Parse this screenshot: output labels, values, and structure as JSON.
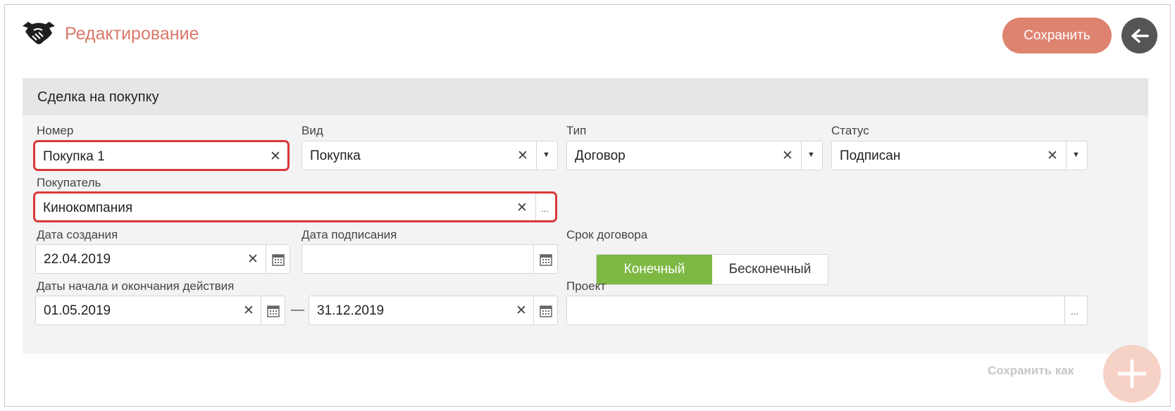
{
  "header": {
    "title": "Редактирование",
    "save_label": "Сохранить",
    "icon": "handshake-icon",
    "back_icon": "arrow-left-icon",
    "accent_color": "#de8370"
  },
  "panel": {
    "title": "Сделка на покупку"
  },
  "fields": {
    "number": {
      "label": "Номер",
      "value": "Покупка 1"
    },
    "kind": {
      "label": "Вид",
      "value": "Покупка"
    },
    "type": {
      "label": "Тип",
      "value": "Договор"
    },
    "status": {
      "label": "Статус",
      "value": "Подписан"
    },
    "buyer": {
      "label": "Покупатель",
      "value": "Кинокомпания"
    },
    "created_date": {
      "label": "Дата создания",
      "value": "22.04.2019"
    },
    "signed_date": {
      "label": "Дата подписания",
      "value": ""
    },
    "contract_term": {
      "label": "Срок договора",
      "options": [
        "Конечный",
        "Бесконечный"
      ],
      "selected": "Конечный"
    },
    "period": {
      "label": "Даты начала и окончания действия",
      "start": "01.05.2019",
      "separator": "—",
      "end": "31.12.2019"
    },
    "project": {
      "label": "Проект",
      "value": ""
    }
  },
  "symbols": {
    "clear": "✕",
    "more": "...",
    "caret": "▼"
  },
  "footer": {
    "save_as_label": "Сохранить как",
    "fab_icon": "plus-icon"
  }
}
